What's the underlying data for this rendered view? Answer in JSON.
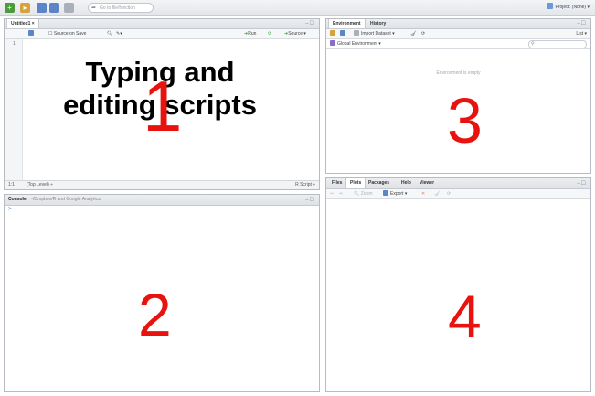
{
  "toolbar": {
    "goto_placeholder": "Go to file/function",
    "project_label": "Project: (None) ▾",
    "icons": [
      "new-file-icon",
      "open-file-icon",
      "save-icon",
      "save-all-icon",
      "print-icon"
    ]
  },
  "source_pane": {
    "tab_label": "Untitled1 ×",
    "source_on_save": "Source on Save",
    "run_label": "Run",
    "source_label": "Source ▾",
    "line_number": "1",
    "status_position": "1:1",
    "status_scope": "(Top Level) ÷",
    "status_type": "R Script ÷",
    "overlay_line1": "Typing and",
    "overlay_line2": "editing scripts",
    "number": "1"
  },
  "console_pane": {
    "title": "Console",
    "path": "~/Dropbox/R and Google Analytics/",
    "prompt": ">",
    "number": "2"
  },
  "environment_pane": {
    "tabs": [
      "Environment",
      "History"
    ],
    "import_dataset": "Import Dataset ▾",
    "list_label": "List ▾",
    "global_env": "Global Environment ▾",
    "empty_text": "Environment is empty",
    "number": "3"
  },
  "files_pane": {
    "tabs": [
      "Files",
      "Plots",
      "Packages",
      "Help",
      "Viewer"
    ],
    "zoom_label": "Zoom",
    "export_label": "Export ▾",
    "number": "4"
  },
  "colors": {
    "accent_red": "#e8120f",
    "run_green": "#2e9b3a"
  }
}
